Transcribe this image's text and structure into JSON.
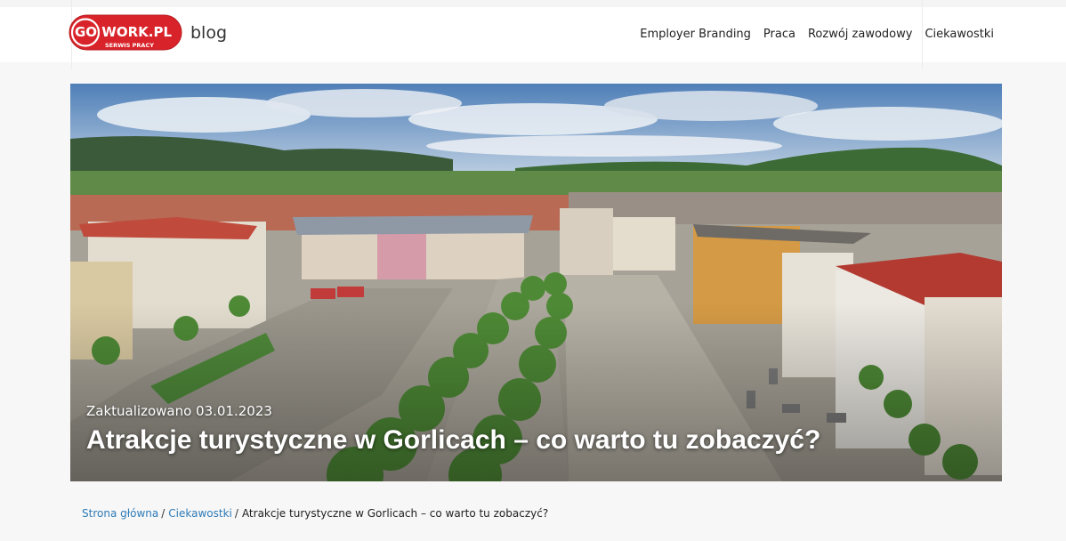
{
  "header": {
    "logo": {
      "text": "GO WORK.PL",
      "subtext": "SERWIS PRACY",
      "color": "#d9232a"
    },
    "blog_label": "blog",
    "nav": [
      {
        "label": "Employer Branding"
      },
      {
        "label": "Praca"
      },
      {
        "label": "Rozwój zawodowy"
      },
      {
        "label": "Ciekawostki"
      }
    ]
  },
  "hero": {
    "updated": "Zaktualizowano 03.01.2023",
    "title": "Atrakcje turystyczne w Gorlicach – co warto tu zobaczyć?"
  },
  "breadcrumb": {
    "home": "Strona główna",
    "category": "Ciekawostki",
    "current": "Atrakcje turystyczne w Gorlicach – co warto tu zobaczyć?",
    "separator": "/"
  },
  "colors": {
    "link": "#2e7bb8",
    "page_background": "#f7f7f7"
  }
}
